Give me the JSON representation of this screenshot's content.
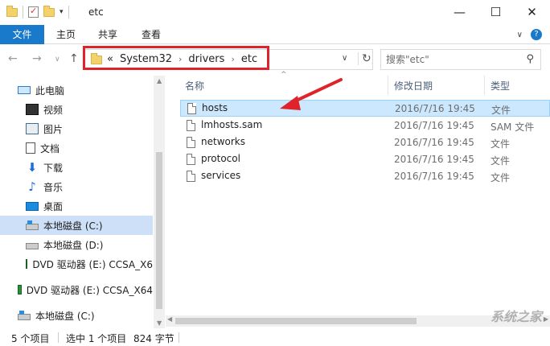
{
  "window": {
    "title": "etc",
    "minimize": "—",
    "maximize": "☐",
    "close": "✕"
  },
  "ribbon": {
    "tabs": [
      "文件",
      "主页",
      "共享",
      "查看"
    ],
    "expand": "∨",
    "help": "?"
  },
  "nav": {
    "back": "←",
    "forward": "→",
    "recent": "∨",
    "up": "↑"
  },
  "address": {
    "prefix": "«",
    "segments": [
      "System32",
      "drivers",
      "etc"
    ],
    "separator": "›",
    "dropdown": "∨",
    "refresh": "↻"
  },
  "search": {
    "placeholder": "搜索\"etc\"",
    "icon": "⚲"
  },
  "navpane": {
    "items": [
      {
        "label": "此电脑",
        "icon": "pc-icon"
      },
      {
        "label": "视频",
        "icon": "video-icon"
      },
      {
        "label": "图片",
        "icon": "pictures-icon"
      },
      {
        "label": "文档",
        "icon": "documents-icon"
      },
      {
        "label": "下载",
        "icon": "download-icon"
      },
      {
        "label": "音乐",
        "icon": "music-icon"
      },
      {
        "label": "桌面",
        "icon": "desktop-icon"
      },
      {
        "label": "本地磁盘 (C:)",
        "icon": "disk-c-icon",
        "selected": true
      },
      {
        "label": "本地磁盘 (D:)",
        "icon": "disk-d-icon"
      },
      {
        "label": "DVD 驱动器 (E:) CCSA_X6",
        "icon": "dvd-icon"
      },
      {
        "label": "DVD 驱动器 (E:) CCSA_X64",
        "icon": "dvd-icon"
      },
      {
        "label": "本地磁盘 (C:)",
        "icon": "disk-c-icon"
      }
    ]
  },
  "columns": {
    "name": "名称",
    "modified": "修改日期",
    "type": "类型",
    "sort_arrow": "^"
  },
  "files": [
    {
      "name": "hosts",
      "modified": "2016/7/16 19:45",
      "type": "文件",
      "selected": true
    },
    {
      "name": "lmhosts.sam",
      "modified": "2016/7/16 19:45",
      "type": "SAM 文件"
    },
    {
      "name": "networks",
      "modified": "2016/7/16 19:45",
      "type": "文件"
    },
    {
      "name": "protocol",
      "modified": "2016/7/16 19:45",
      "type": "文件"
    },
    {
      "name": "services",
      "modified": "2016/7/16 19:45",
      "type": "文件"
    }
  ],
  "status": {
    "count": "5 个项目",
    "selected": "选中 1 个项目",
    "size": "824 字节"
  },
  "watermark": "系统之家",
  "colors": {
    "accent": "#1979ca",
    "highlight": "#e0232b",
    "selection": "#cce8ff"
  }
}
